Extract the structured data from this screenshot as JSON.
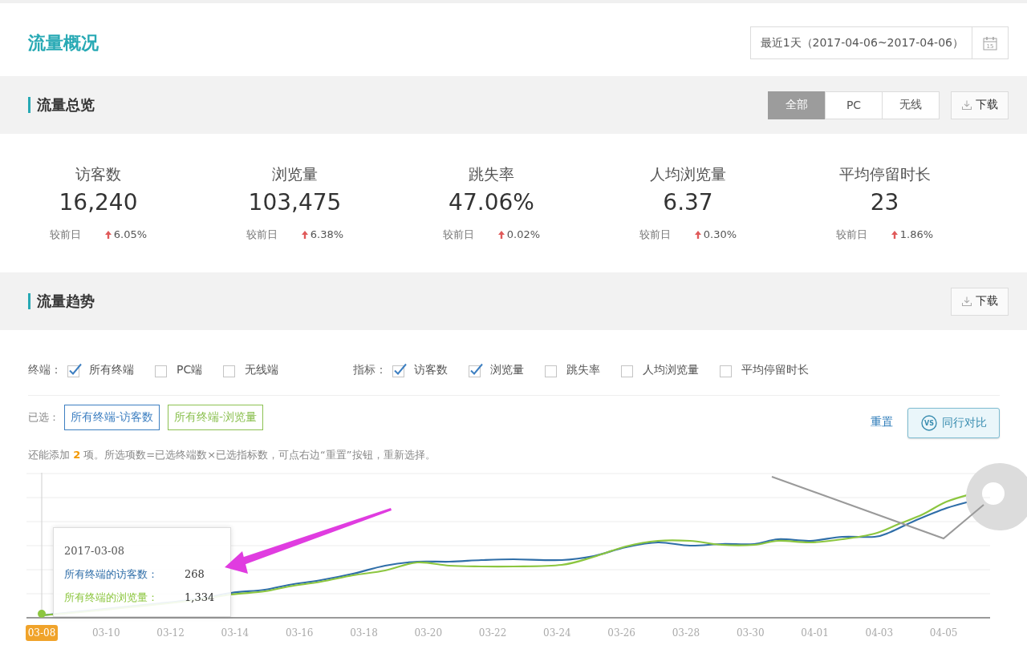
{
  "header": {
    "title": "流量概况",
    "date_range": "最近1天（2017-04-06~2017-04-06）",
    "calendar_day": "15"
  },
  "overview": {
    "title": "流量总览",
    "tabs": [
      {
        "label": "全部",
        "selected": true
      },
      {
        "label": "PC",
        "selected": false
      },
      {
        "label": "无线",
        "selected": false
      }
    ],
    "download_button": "下载",
    "metrics": [
      {
        "label": "访客数",
        "value": "16,240",
        "compare_label": "较前日",
        "change": "6.05%",
        "increase": true
      },
      {
        "label": "浏览量",
        "value": "103,475",
        "compare_label": "较前日",
        "change": "6.38%",
        "increase": true
      },
      {
        "label": "跳失率",
        "value": "47.06%",
        "compare_label": "较前日",
        "change": "0.02%",
        "increase": true
      },
      {
        "label": "人均浏览量",
        "value": "6.37",
        "compare_label": "较前日",
        "change": "0.30%",
        "increase": true
      },
      {
        "label": "平均停留时长",
        "value": "23",
        "compare_label": "较前日",
        "change": "1.86%",
        "increase": true
      }
    ]
  },
  "trend": {
    "title": "流量趋势",
    "download_button": "下载",
    "filters": [
      {
        "label": "终端：",
        "options": [
          {
            "label": "所有终端",
            "checked": true
          },
          {
            "label": "PC端",
            "checked": false
          },
          {
            "label": "无线端",
            "checked": false
          }
        ]
      },
      {
        "label": "指标：",
        "options": [
          {
            "label": "访客数",
            "checked": true
          },
          {
            "label": "浏览量",
            "checked": true
          },
          {
            "label": "跳失率",
            "checked": false
          },
          {
            "label": "人均浏览量",
            "checked": false
          },
          {
            "label": "平均停留时长",
            "checked": false
          }
        ]
      }
    ],
    "selected_label": "已选：",
    "selected_tags": [
      {
        "label": "所有终端-访客数",
        "color": "#3d7fc1"
      },
      {
        "label": "所有终端-浏览量",
        "color": "#8cc152"
      }
    ],
    "reset_link": "重置",
    "compare_button": {
      "badge": "VS",
      "label": "同行对比"
    },
    "hint": "还能添加 **2** 项。所选项数=已选终端数×已选指标数，可点右边“重置”按钮，重新选择。",
    "chart": {
      "x_labels": [
        {
          "label": "03-08",
          "selected": true
        },
        {
          "label": "03-10",
          "selected": false
        },
        {
          "label": "03-12",
          "selected": false
        },
        {
          "label": "03-14",
          "selected": false
        },
        {
          "label": "03-16",
          "selected": false
        },
        {
          "label": "03-18",
          "selected": false
        },
        {
          "label": "03-20",
          "selected": false
        },
        {
          "label": "03-22",
          "selected": false
        },
        {
          "label": "03-24",
          "selected": false
        },
        {
          "label": "03-26",
          "selected": false
        },
        {
          "label": "03-28",
          "selected": false
        },
        {
          "label": "03-30",
          "selected": false
        },
        {
          "label": "04-01",
          "selected": false
        },
        {
          "label": "04-03",
          "selected": false
        },
        {
          "label": "04-05",
          "selected": false
        }
      ],
      "tooltip": {
        "date": "2017-03-08",
        "rows": [
          {
            "label": "所有终端的访客数：",
            "value": "268",
            "color": "#2f6ea8"
          },
          {
            "label": "所有终端的浏览量：",
            "value": "1,334",
            "color": "#8cc63f"
          }
        ]
      }
    }
  }
}
